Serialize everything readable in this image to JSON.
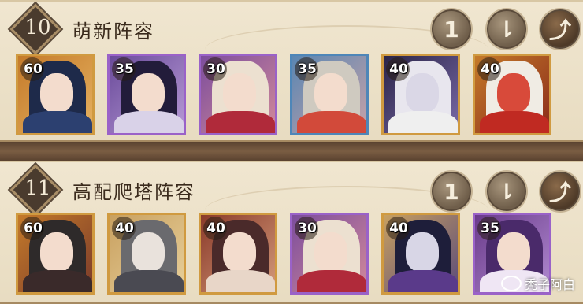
{
  "team1": {
    "rank": "10",
    "title": "萌新阵容",
    "cards": [
      {
        "level": "60"
      },
      {
        "level": "35"
      },
      {
        "level": "30"
      },
      {
        "level": "35"
      },
      {
        "level": "40"
      },
      {
        "level": "40"
      }
    ]
  },
  "team2": {
    "rank": "11",
    "title": "高配爬塔阵容",
    "cards": [
      {
        "level": "60"
      },
      {
        "level": "40"
      },
      {
        "level": "40"
      },
      {
        "level": "30"
      },
      {
        "level": "40"
      },
      {
        "level": "35"
      }
    ]
  },
  "controls": {
    "move_up": "1",
    "move_down": "⇂",
    "share_icon": "share-icon"
  },
  "watermark": "秃子阿白"
}
